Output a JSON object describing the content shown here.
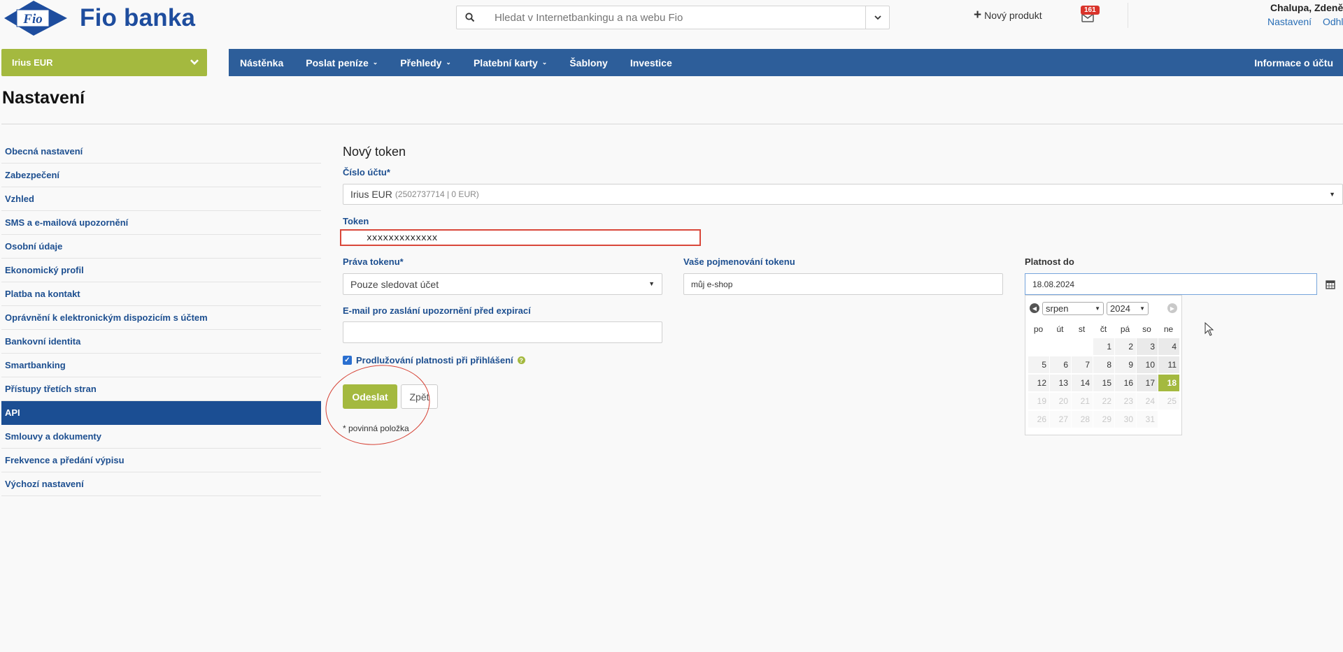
{
  "header": {
    "brand": "Fio banka",
    "logo_mark": "Fio",
    "search_placeholder": "Hledat v Internetbankingu a na webu Fio",
    "new_product": "Nový produkt",
    "messages_count": "161",
    "user_name": "Chalupa, Zdeněk",
    "settings_link": "Nastavení",
    "logout_link": "Odhlásit"
  },
  "account_select": "Irius EUR",
  "nav": {
    "items": [
      {
        "label": "Nástěnka",
        "caret": ""
      },
      {
        "label": "Poslat peníze",
        "caret": "⌄"
      },
      {
        "label": "Přehledy",
        "caret": "⌄"
      },
      {
        "label": "Platební karty",
        "caret": "⌄"
      },
      {
        "label": "Šablony",
        "caret": ""
      },
      {
        "label": "Investice",
        "caret": ""
      }
    ],
    "right": "Informace o účtu"
  },
  "page_title": "Nastavení",
  "sidebar": {
    "items": [
      "Obecná nastavení",
      "Zabezpečení",
      "Vzhled",
      "SMS a e-mailová upozornění",
      "Osobní údaje",
      "Ekonomický profil",
      "Platba na kontakt",
      "Oprávnění k elektronickým dispozicím s účtem",
      "Bankovní identita",
      "Smartbanking",
      "Přístupy třetích stran",
      "API",
      "Smlouvy a dokumenty",
      "Frekvence a předání výpisu",
      "Výchozí nastavení"
    ],
    "active": "API"
  },
  "form": {
    "title": "Nový token",
    "account_label": "Číslo účtu*",
    "account_value": "Irius EUR",
    "account_detail": "(2502737714   |   0 EUR)",
    "token_label": "Token",
    "token_value": "xxxxxxxxxxxxx",
    "rights_label": "Práva tokenu*",
    "rights_value": "Pouze sledovat účet",
    "name_label": "Vaše pojmenování tokenu",
    "name_value": "můj e-shop",
    "validity_label": "Platnost do",
    "validity_value": "18.08.2024",
    "email_label": "E-mail pro zaslání upozornění před expirací",
    "email_value": "",
    "extend_label": "Prodlužování platnosti při přihlášení",
    "extend_checked": true,
    "submit": "Odeslat",
    "back": "Zpět",
    "required_note": "* povinná položka"
  },
  "calendar": {
    "month": "srpen",
    "year": "2024",
    "weekdays": [
      "po",
      "út",
      "st",
      "čt",
      "pá",
      "so",
      "ne"
    ],
    "selected_day": 18,
    "rows": [
      [
        "",
        "",
        "",
        "1",
        "2",
        "3",
        "4"
      ],
      [
        "5",
        "6",
        "7",
        "8",
        "9",
        "10",
        "11"
      ],
      [
        "12",
        "13",
        "14",
        "15",
        "16",
        "17",
        "18"
      ],
      [
        "19",
        "20",
        "21",
        "22",
        "23",
        "24",
        "25"
      ],
      [
        "26",
        "27",
        "28",
        "29",
        "30",
        "31",
        ""
      ]
    ],
    "disabled_from": 19
  },
  "colors": {
    "brand_blue": "#1e4d9e",
    "nav_blue": "#2d5e9a",
    "accent_green": "#a4b93f",
    "annotation_red": "#d64235"
  }
}
